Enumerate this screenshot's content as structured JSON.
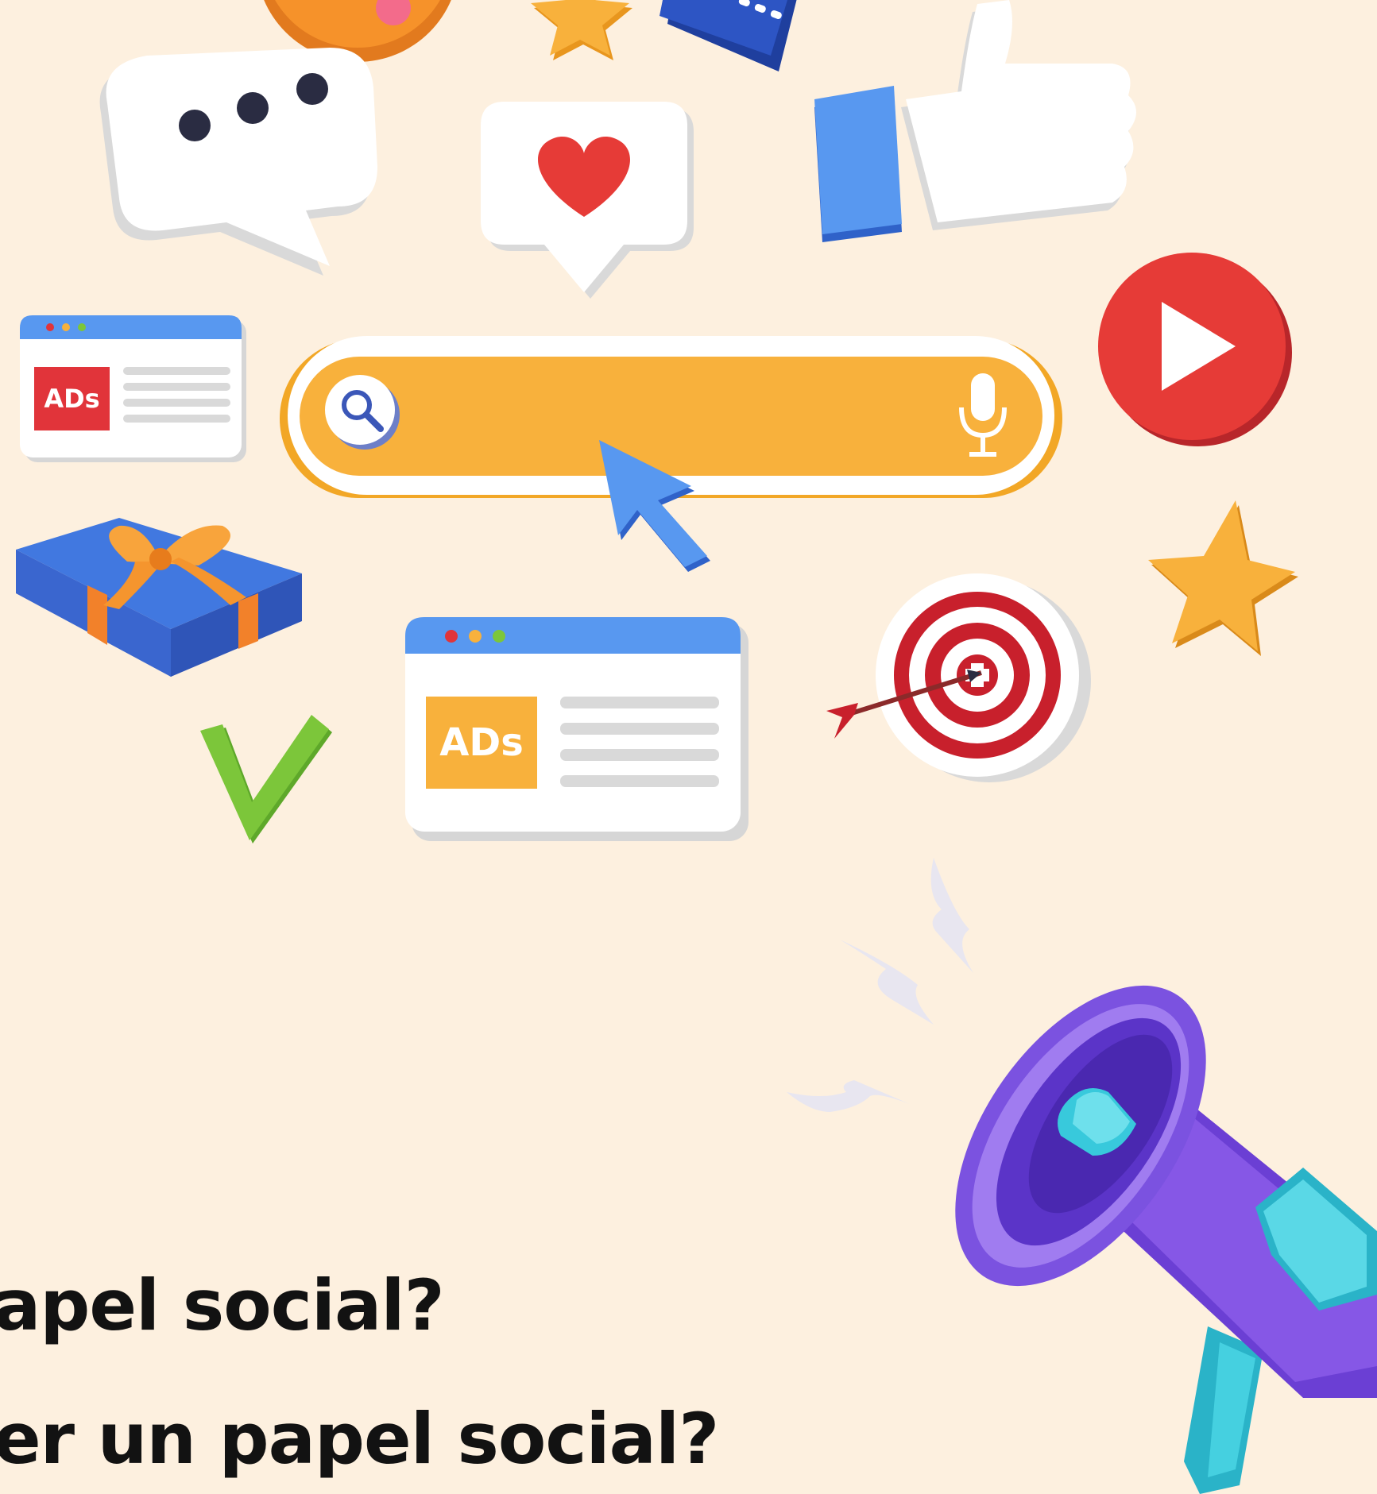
{
  "ads_small": {
    "label": "ADs"
  },
  "ads_large": {
    "label": "ADs"
  },
  "search_bar": {
    "value": ""
  },
  "captions": [
    "apel social?",
    "er un papel social?"
  ],
  "colors": {
    "background": "#fdf0df",
    "search_yellow": "#f8b13c",
    "ads_red": "#e1343a",
    "ads_orange": "#f8b13c",
    "browser_blue": "#5898f0",
    "play_red": "#e63b37",
    "heart_red": "#e63b37",
    "check_green": "#7cc63a",
    "megaphone_purple": "#7b52e0",
    "megaphone_cyan": "#38c9dc"
  }
}
